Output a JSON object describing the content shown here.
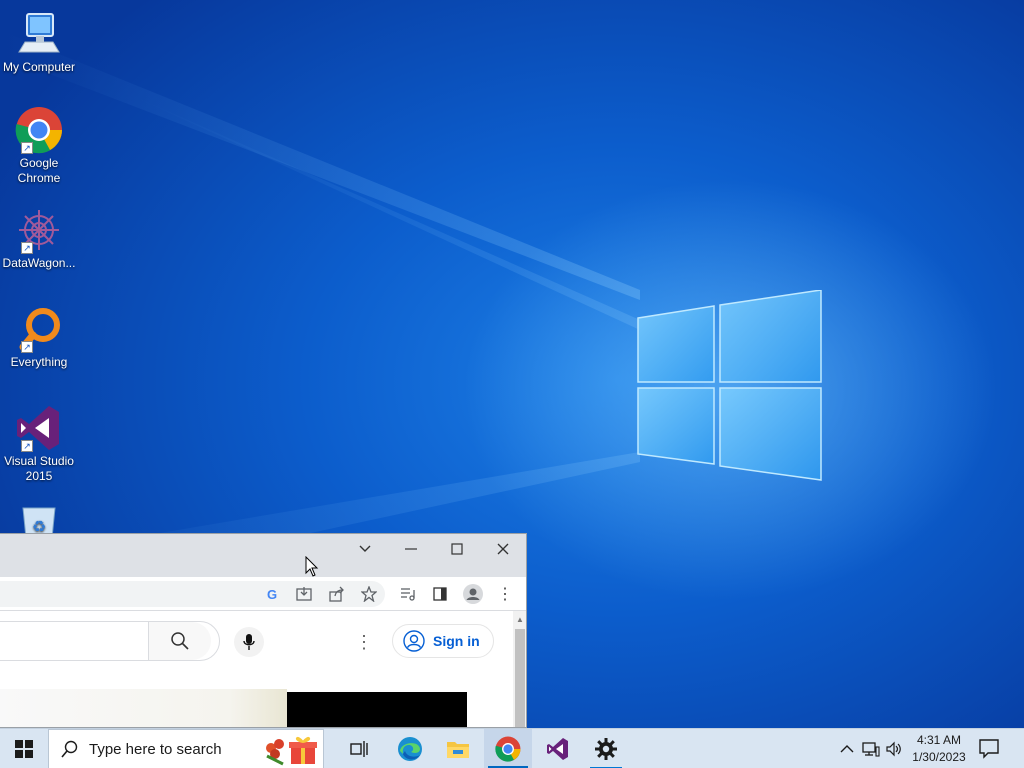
{
  "desktop": {
    "icons": [
      {
        "label": "My Computer",
        "icon": "computer-icon"
      },
      {
        "label": "Google Chrome",
        "icon": "chrome-icon"
      },
      {
        "label": "DataWagon...",
        "icon": "datawagon-icon"
      },
      {
        "label": "Everything",
        "icon": "everything-search-icon"
      },
      {
        "label": "Visual Studio 2015",
        "icon": "visual-studio-icon"
      },
      {
        "label": "",
        "icon": "recycle-bin-icon"
      }
    ]
  },
  "browser": {
    "window_controls": [
      "tab-search-chevron",
      "minimize",
      "maximize",
      "close"
    ],
    "toolbar_icons": [
      "google-lens-icon",
      "install-app-icon",
      "share-icon",
      "bookmark-star-icon",
      "media-queue-icon",
      "side-panel-icon",
      "profile-icon",
      "menu-kebab-icon"
    ],
    "page": {
      "search_placeholder": "",
      "sign_in_label": "Sign in"
    }
  },
  "taskbar": {
    "search_placeholder": "Type here to search",
    "apps": [
      "task-view-icon",
      "edge-icon",
      "file-explorer-icon",
      "chrome-icon",
      "visual-studio-icon",
      "settings-gear-icon"
    ],
    "active_app": "chrome-icon",
    "clock": {
      "time": "4:31 AM",
      "date": "1/30/2023"
    },
    "accent_color": "#0067c0"
  }
}
